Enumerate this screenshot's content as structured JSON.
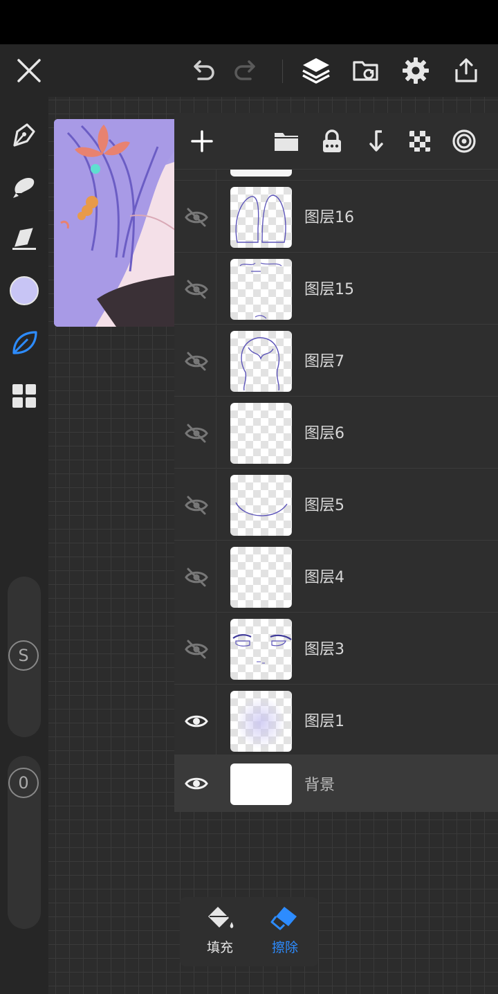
{
  "toolbar": {
    "close": "close-icon",
    "undo": "undo-icon",
    "redo": "redo-icon",
    "layers": "layers-icon",
    "gallery": "gallery-icon",
    "settings": "gear-icon",
    "share": "share-icon"
  },
  "left_tools": [
    "pen-icon",
    "smudge-icon",
    "eraser-icon",
    "color-swatch",
    "leaf-brush-icon",
    "grid-menu-icon"
  ],
  "colors": {
    "current_color": "#c8c5f5",
    "accent": "#2d8cff",
    "panel": "#2e2e2e",
    "canvas": "#2c2c2c"
  },
  "sliders": {
    "size_label": "S",
    "opacity_label": "0"
  },
  "layer_panel": {
    "header_buttons": [
      "add-icon",
      "folder-icon",
      "lock-icon",
      "merge-down-icon",
      "checkerboard-icon",
      "target-icon"
    ],
    "layers": [
      {
        "name": "图层16",
        "visible": false
      },
      {
        "name": "图层15",
        "visible": false
      },
      {
        "name": "图层7",
        "visible": false
      },
      {
        "name": "图层6",
        "visible": false
      },
      {
        "name": "图层5",
        "visible": false
      },
      {
        "name": "图层4",
        "visible": false
      },
      {
        "name": "图层3",
        "visible": false
      },
      {
        "name": "图层1",
        "visible": true
      }
    ],
    "background": {
      "name": "背景",
      "visible": true
    }
  },
  "bottom_popup": {
    "fill_label": "填充",
    "erase_label": "擦除"
  }
}
